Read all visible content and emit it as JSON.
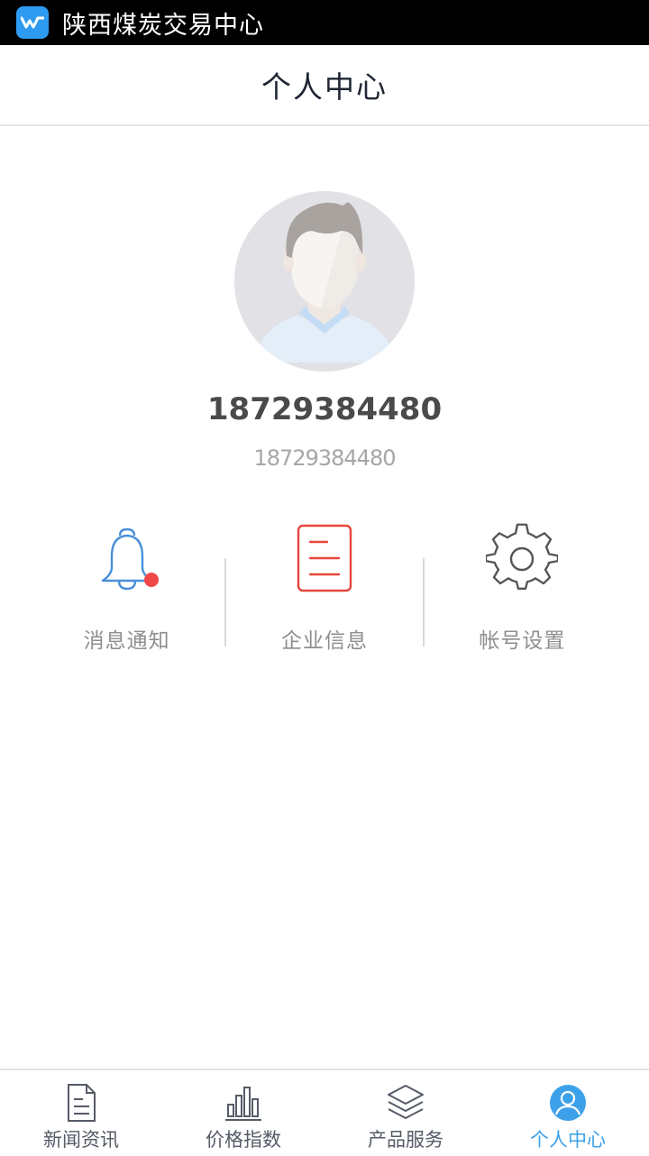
{
  "statusbar": {
    "app_name": "陕西煤炭交易中心",
    "icon": "app-logo-icon"
  },
  "header": {
    "title": "个人中心"
  },
  "profile": {
    "avatar": "avatar",
    "name": "18729384480",
    "subtitle": "18729384480"
  },
  "actions": [
    {
      "label": "消息通知",
      "icon": "bell-icon",
      "has_badge": true,
      "color": "#4a90d9"
    },
    {
      "label": "企业信息",
      "icon": "document-icon",
      "color": "#e8453c"
    },
    {
      "label": "帐号设置",
      "icon": "gear-icon",
      "color": "#555555"
    }
  ],
  "tabbar": {
    "tabs": [
      {
        "label": "新闻资讯",
        "icon": "news-document-icon",
        "active": false
      },
      {
        "label": "价格指数",
        "icon": "bar-chart-icon",
        "active": false
      },
      {
        "label": "产品服务",
        "icon": "layers-icon",
        "active": false
      },
      {
        "label": "个人中心",
        "icon": "user-profile-icon",
        "active": true
      }
    ]
  },
  "colors": {
    "accent": "#3da1ea",
    "badge": "#f04848",
    "text_dark": "#4a4a4a"
  }
}
